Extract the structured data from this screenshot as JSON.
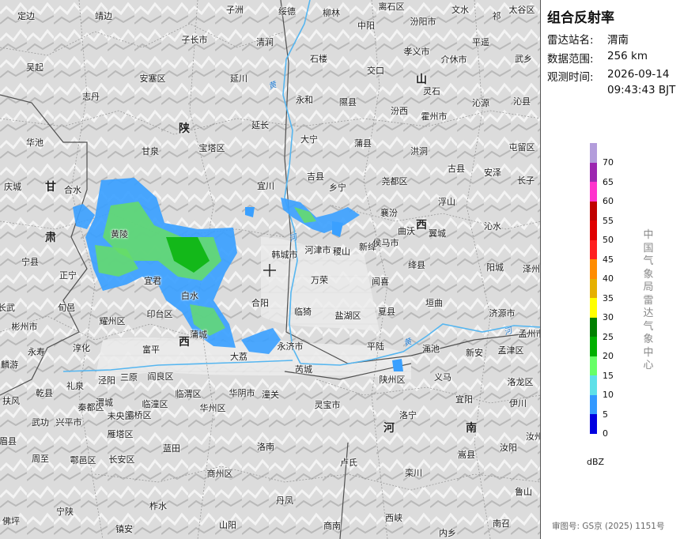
{
  "map": {
    "provinces": [
      {
        "text": "陕",
        "pos": [
          233,
          162
        ]
      },
      {
        "text": "甘",
        "pos": [
          64,
          236
        ]
      },
      {
        "text": "肃",
        "pos": [
          64,
          300
        ]
      },
      {
        "text": "西",
        "pos": [
          533,
          284
        ]
      },
      {
        "text": "山",
        "pos": [
          533,
          100
        ]
      },
      {
        "text": "西",
        "pos": [
          233,
          432
        ]
      },
      {
        "text": "河",
        "pos": [
          492,
          541
        ]
      },
      {
        "text": "南",
        "pos": [
          596,
          541
        ]
      }
    ],
    "places": [
      {
        "text": "定边",
        "pos": [
          33,
          20
        ]
      },
      {
        "text": "靖边",
        "pos": [
          131,
          20
        ]
      },
      {
        "text": "子洲",
        "pos": [
          297,
          12
        ]
      },
      {
        "text": "绥德",
        "pos": [
          363,
          14
        ]
      },
      {
        "text": "柳林",
        "pos": [
          419,
          16
        ]
      },
      {
        "text": "离石区",
        "pos": [
          495,
          8
        ]
      },
      {
        "text": "汾阳市",
        "pos": [
          535,
          27
        ]
      },
      {
        "text": "文水",
        "pos": [
          582,
          12
        ]
      },
      {
        "text": "祁",
        "pos": [
          628,
          20
        ]
      },
      {
        "text": "太谷区",
        "pos": [
          660,
          12
        ]
      },
      {
        "text": "子长市",
        "pos": [
          246,
          50
        ]
      },
      {
        "text": "清涧",
        "pos": [
          335,
          53
        ]
      },
      {
        "text": "中阳",
        "pos": [
          463,
          32
        ]
      },
      {
        "text": "孝义市",
        "pos": [
          527,
          65
        ]
      },
      {
        "text": "平遥",
        "pos": [
          608,
          53
        ]
      },
      {
        "text": "武乡",
        "pos": [
          662,
          74
        ]
      },
      {
        "text": "吴起",
        "pos": [
          44,
          85
        ]
      },
      {
        "text": "安塞区",
        "pos": [
          193,
          99
        ]
      },
      {
        "text": "延川",
        "pos": [
          302,
          99
        ]
      },
      {
        "text": "石楼",
        "pos": [
          403,
          74
        ]
      },
      {
        "text": "交口",
        "pos": [
          475,
          89
        ]
      },
      {
        "text": "介休市",
        "pos": [
          574,
          75
        ]
      },
      {
        "text": "志丹",
        "pos": [
          115,
          122
        ]
      },
      {
        "text": "永和",
        "pos": [
          385,
          126
        ]
      },
      {
        "text": "隰县",
        "pos": [
          440,
          129
        ]
      },
      {
        "text": "灵石",
        "pos": [
          546,
          115
        ]
      },
      {
        "text": "沁源",
        "pos": [
          608,
          130
        ]
      },
      {
        "text": "沁县",
        "pos": [
          660,
          128
        ]
      },
      {
        "text": "延长",
        "pos": [
          329,
          158
        ]
      },
      {
        "text": "汾西",
        "pos": [
          505,
          140
        ]
      },
      {
        "text": "霍州市",
        "pos": [
          549,
          147
        ]
      },
      {
        "text": "华池",
        "pos": [
          44,
          180
        ]
      },
      {
        "text": "甘泉",
        "pos": [
          190,
          191
        ]
      },
      {
        "text": "宝塔区",
        "pos": [
          268,
          187
        ]
      },
      {
        "text": "大宁",
        "pos": [
          391,
          176
        ]
      },
      {
        "text": "蒲县",
        "pos": [
          459,
          181
        ]
      },
      {
        "text": "洪洞",
        "pos": [
          530,
          191
        ]
      },
      {
        "text": "屯留区",
        "pos": [
          660,
          186
        ]
      },
      {
        "text": "吉县",
        "pos": [
          399,
          223
        ]
      },
      {
        "text": "尧都区",
        "pos": [
          499,
          229
        ]
      },
      {
        "text": "古县",
        "pos": [
          577,
          213
        ]
      },
      {
        "text": "安泽",
        "pos": [
          623,
          218
        ]
      },
      {
        "text": "长子",
        "pos": [
          665,
          228
        ]
      },
      {
        "text": "庆城",
        "pos": [
          16,
          236
        ]
      },
      {
        "text": "合水",
        "pos": [
          92,
          240
        ]
      },
      {
        "text": "宜川",
        "pos": [
          336,
          235
        ]
      },
      {
        "text": "乡宁",
        "pos": [
          427,
          237
        ]
      },
      {
        "text": "浮山",
        "pos": [
          565,
          255
        ]
      },
      {
        "text": "襄汾",
        "pos": [
          492,
          269
        ]
      },
      {
        "text": "曲沃",
        "pos": [
          514,
          292
        ]
      },
      {
        "text": "翼城",
        "pos": [
          553,
          295
        ]
      },
      {
        "text": "沁水",
        "pos": [
          623,
          286
        ]
      },
      {
        "text": "宁县",
        "pos": [
          38,
          331
        ]
      },
      {
        "text": "黄陵",
        "pos": [
          151,
          296
        ]
      },
      {
        "text": "韩城市",
        "pos": [
          360,
          322
        ]
      },
      {
        "text": "河津市",
        "pos": [
          402,
          316
        ]
      },
      {
        "text": "稷山",
        "pos": [
          432,
          318
        ]
      },
      {
        "text": "新绛",
        "pos": [
          465,
          312
        ]
      },
      {
        "text": "侯马市",
        "pos": [
          488,
          307
        ]
      },
      {
        "text": "绛县",
        "pos": [
          527,
          335
        ]
      },
      {
        "text": "阳城",
        "pos": [
          626,
          338
        ]
      },
      {
        "text": "泽州",
        "pos": [
          672,
          340
        ]
      },
      {
        "text": "正宁",
        "pos": [
          86,
          348
        ]
      },
      {
        "text": "宜君",
        "pos": [
          193,
          355
        ]
      },
      {
        "text": "万荣",
        "pos": [
          404,
          354
        ]
      },
      {
        "text": "闻喜",
        "pos": [
          481,
          356
        ]
      },
      {
        "text": "旬邑",
        "pos": [
          84,
          389
        ]
      },
      {
        "text": "白水",
        "pos": [
          240,
          374
        ]
      },
      {
        "text": "合阳",
        "pos": [
          329,
          383
        ]
      },
      {
        "text": "临猗",
        "pos": [
          383,
          394
        ]
      },
      {
        "text": "盐湖区",
        "pos": [
          440,
          399
        ]
      },
      {
        "text": "夏县",
        "pos": [
          489,
          394
        ]
      },
      {
        "text": "垣曲",
        "pos": [
          549,
          383
        ]
      },
      {
        "text": "济源市",
        "pos": [
          635,
          396
        ]
      },
      {
        "text": "长武",
        "pos": [
          8,
          389
        ]
      },
      {
        "text": "彬州市",
        "pos": [
          31,
          413
        ]
      },
      {
        "text": "耀州区",
        "pos": [
          142,
          406
        ]
      },
      {
        "text": "印台区",
        "pos": [
          202,
          397
        ]
      },
      {
        "text": "蒲城",
        "pos": [
          251,
          423
        ]
      },
      {
        "text": "孟州市",
        "pos": [
          672,
          422
        ]
      },
      {
        "text": "永寿",
        "pos": [
          46,
          445
        ]
      },
      {
        "text": "淳化",
        "pos": [
          103,
          440
        ]
      },
      {
        "text": "富平",
        "pos": [
          191,
          442
        ]
      },
      {
        "text": "大荔",
        "pos": [
          302,
          451
        ]
      },
      {
        "text": "永济市",
        "pos": [
          367,
          438
        ]
      },
      {
        "text": "平陆",
        "pos": [
          475,
          438
        ]
      },
      {
        "text": "渑池",
        "pos": [
          545,
          441
        ]
      },
      {
        "text": "新安",
        "pos": [
          600,
          446
        ]
      },
      {
        "text": "孟津区",
        "pos": [
          646,
          443
        ]
      },
      {
        "text": "麟游",
        "pos": [
          12,
          461
        ]
      },
      {
        "text": "三原",
        "pos": [
          163,
          477
        ]
      },
      {
        "text": "阎良区",
        "pos": [
          203,
          476
        ]
      },
      {
        "text": "芮城",
        "pos": [
          384,
          467
        ]
      },
      {
        "text": "陕州区",
        "pos": [
          496,
          480
        ]
      },
      {
        "text": "义马",
        "pos": [
          560,
          477
        ]
      },
      {
        "text": "洛龙区",
        "pos": [
          658,
          483
        ]
      },
      {
        "text": "乾县",
        "pos": [
          56,
          497
        ]
      },
      {
        "text": "礼泉",
        "pos": [
          95,
          488
        ]
      },
      {
        "text": "泾阳",
        "pos": [
          135,
          481
        ]
      },
      {
        "text": "临潼区",
        "pos": [
          196,
          511
        ]
      },
      {
        "text": "临渭区",
        "pos": [
          238,
          498
        ]
      },
      {
        "text": "华阴市",
        "pos": [
          306,
          497
        ]
      },
      {
        "text": "潼关",
        "pos": [
          342,
          499
        ]
      },
      {
        "text": "宜阳",
        "pos": [
          587,
          505
        ]
      },
      {
        "text": "伊川",
        "pos": [
          655,
          510
        ]
      },
      {
        "text": "扶风",
        "pos": [
          14,
          507
        ]
      },
      {
        "text": "武功",
        "pos": [
          51,
          534
        ]
      },
      {
        "text": "兴平市",
        "pos": [
          87,
          534
        ]
      },
      {
        "text": "秦都区",
        "pos": [
          115,
          515
        ]
      },
      {
        "text": "渭城",
        "pos": [
          132,
          509
        ]
      },
      {
        "text": "未央区",
        "pos": [
          152,
          526
        ]
      },
      {
        "text": "灞桥区",
        "pos": [
          175,
          525
        ]
      },
      {
        "text": "华州区",
        "pos": [
          269,
          516
        ]
      },
      {
        "text": "灵宝市",
        "pos": [
          414,
          512
        ]
      },
      {
        "text": "洛宁",
        "pos": [
          516,
          525
        ]
      },
      {
        "text": "眉县",
        "pos": [
          10,
          558
        ]
      },
      {
        "text": "雁塔区",
        "pos": [
          152,
          549
        ]
      },
      {
        "text": "嵩县",
        "pos": [
          590,
          575
        ]
      },
      {
        "text": "汝阳",
        "pos": [
          643,
          566
        ]
      },
      {
        "text": "汝州",
        "pos": [
          676,
          552
        ]
      },
      {
        "text": "周至",
        "pos": [
          51,
          580
        ]
      },
      {
        "text": "鄠邑区",
        "pos": [
          105,
          582
        ]
      },
      {
        "text": "长安区",
        "pos": [
          154,
          581
        ]
      },
      {
        "text": "蓝田",
        "pos": [
          217,
          567
        ]
      },
      {
        "text": "洛南",
        "pos": [
          336,
          565
        ]
      },
      {
        "text": "卢氏",
        "pos": [
          441,
          585
        ]
      },
      {
        "text": "商州区",
        "pos": [
          278,
          599
        ]
      },
      {
        "text": "栾川",
        "pos": [
          523,
          598
        ]
      },
      {
        "text": "鲁山",
        "pos": [
          662,
          622
        ]
      },
      {
        "text": "宁陕",
        "pos": [
          82,
          647
        ]
      },
      {
        "text": "柞水",
        "pos": [
          200,
          640
        ]
      },
      {
        "text": "丹凤",
        "pos": [
          360,
          633
        ]
      },
      {
        "text": "佛坪",
        "pos": [
          14,
          659
        ]
      },
      {
        "text": "山阳",
        "pos": [
          288,
          664
        ]
      },
      {
        "text": "商南",
        "pos": [
          420,
          665
        ]
      },
      {
        "text": "西峡",
        "pos": [
          498,
          655
        ]
      },
      {
        "text": "镇安",
        "pos": [
          157,
          669
        ]
      },
      {
        "text": "南召",
        "pos": [
          634,
          662
        ]
      },
      {
        "text": "内乡",
        "pos": [
          566,
          674
        ]
      }
    ],
    "rivers": [
      {
        "text": "黄",
        "pos": [
          344,
          107
        ]
      },
      {
        "text": "河",
        "pos": [
          370,
          300
        ]
      },
      {
        "text": "黄",
        "pos": [
          515,
          432
        ]
      },
      {
        "text": "河",
        "pos": [
          642,
          418
        ]
      }
    ]
  },
  "panel": {
    "title": "组合反射率",
    "station_label": "雷达站名:",
    "station_value": "渭南",
    "range_label": "数据范围:",
    "range_value": "256 km",
    "time_label": "观测时间:",
    "time_date": "2026-09-14",
    "time_clock": "09:43:43 BJT",
    "organization": "中国气象局雷达气象中心",
    "review_no": "审图号: GS京 (2025) 1151号"
  },
  "legend": {
    "unit": "dBZ",
    "labels": [
      "70",
      "65",
      "60",
      "55",
      "50",
      "45",
      "40",
      "35",
      "30",
      "25",
      "20",
      "15",
      "10",
      "5",
      "0"
    ],
    "colors": [
      "#b39ddb",
      "#9c27b0",
      "#ff33cc",
      "#c00000",
      "#e00000",
      "#ff2020",
      "#ff8c00",
      "#e5b000",
      "#ffff00",
      "#008000",
      "#00b000",
      "#66ff66",
      "#5ee0e8",
      "#3399ff",
      "#0000e0"
    ]
  },
  "colors": {
    "echo_weak": "#3aa0ff",
    "echo_mid": "#66dd66",
    "echo_strong": "#00b000",
    "river": "#56b6f0"
  }
}
